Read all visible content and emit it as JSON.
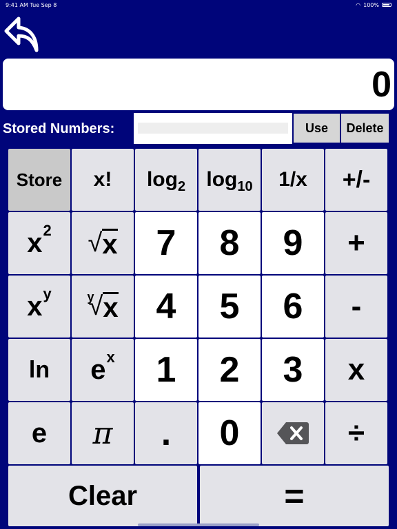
{
  "status": {
    "left": "9:41 AM  Tue Sep 8",
    "right": "100%"
  },
  "display": {
    "value": "0"
  },
  "stored": {
    "label": "Stored Numbers:",
    "value": "",
    "use_label": "Use",
    "delete_label": "Delete"
  },
  "keys": {
    "store": "Store",
    "factorial": "x!",
    "log": "log",
    "log2_base": "2",
    "log10_base": "10",
    "reciprocal": "1/x",
    "negate": "+/-",
    "x": "x",
    "square_exp": "2",
    "sqrt_symbol": "√",
    "power_exp": "y",
    "root_index": "y",
    "seven": "7",
    "eight": "8",
    "nine": "9",
    "plus": "+",
    "four": "4",
    "five": "5",
    "six": "6",
    "minus": "-",
    "ln": "ln",
    "e": "e",
    "exp_sup": "x",
    "one": "1",
    "two": "2",
    "three": "3",
    "multiply": "x",
    "euler": "e",
    "pi": "π",
    "decimal": ".",
    "zero": "0",
    "divide": "÷",
    "clear": "Clear",
    "equals": "="
  },
  "icons": {
    "back": "back-arrow-icon",
    "backspace": "backspace-icon"
  },
  "colors": {
    "background": "#00057a",
    "key_gray": "#e3e3e8",
    "key_white": "#ffffff",
    "store_key": "#c9c9c9"
  }
}
